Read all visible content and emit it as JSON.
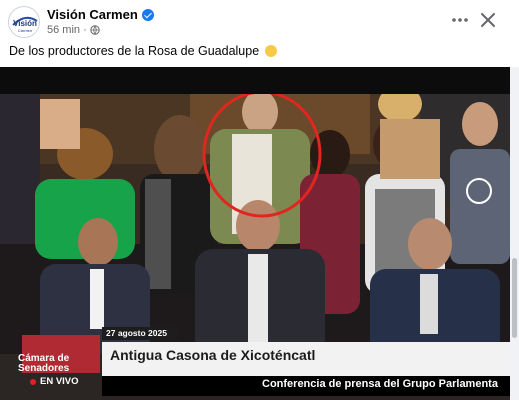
{
  "post": {
    "author": "Visión Carmen",
    "time": "56 min ·",
    "caption": "De los productores de la Rosa de Guadalupe",
    "more_icon": "more-icon",
    "close_icon": "close-icon"
  },
  "avatar": {
    "line1": "Visión",
    "line2": "Carmen"
  },
  "video": {
    "date": "27 agosto 2025",
    "title": "Antigua Casona de Xicoténcatl",
    "subtitle": "Conferencia de prensa del Grupo Parlamenta",
    "channel_line1": "Cámara de",
    "channel_line2": "Senadores",
    "live_label": "EN VIVO",
    "highlight_color": "#e0261f"
  },
  "colors": {
    "verified": "#1877f2",
    "text_primary": "#050505",
    "text_secondary": "#65676b"
  }
}
